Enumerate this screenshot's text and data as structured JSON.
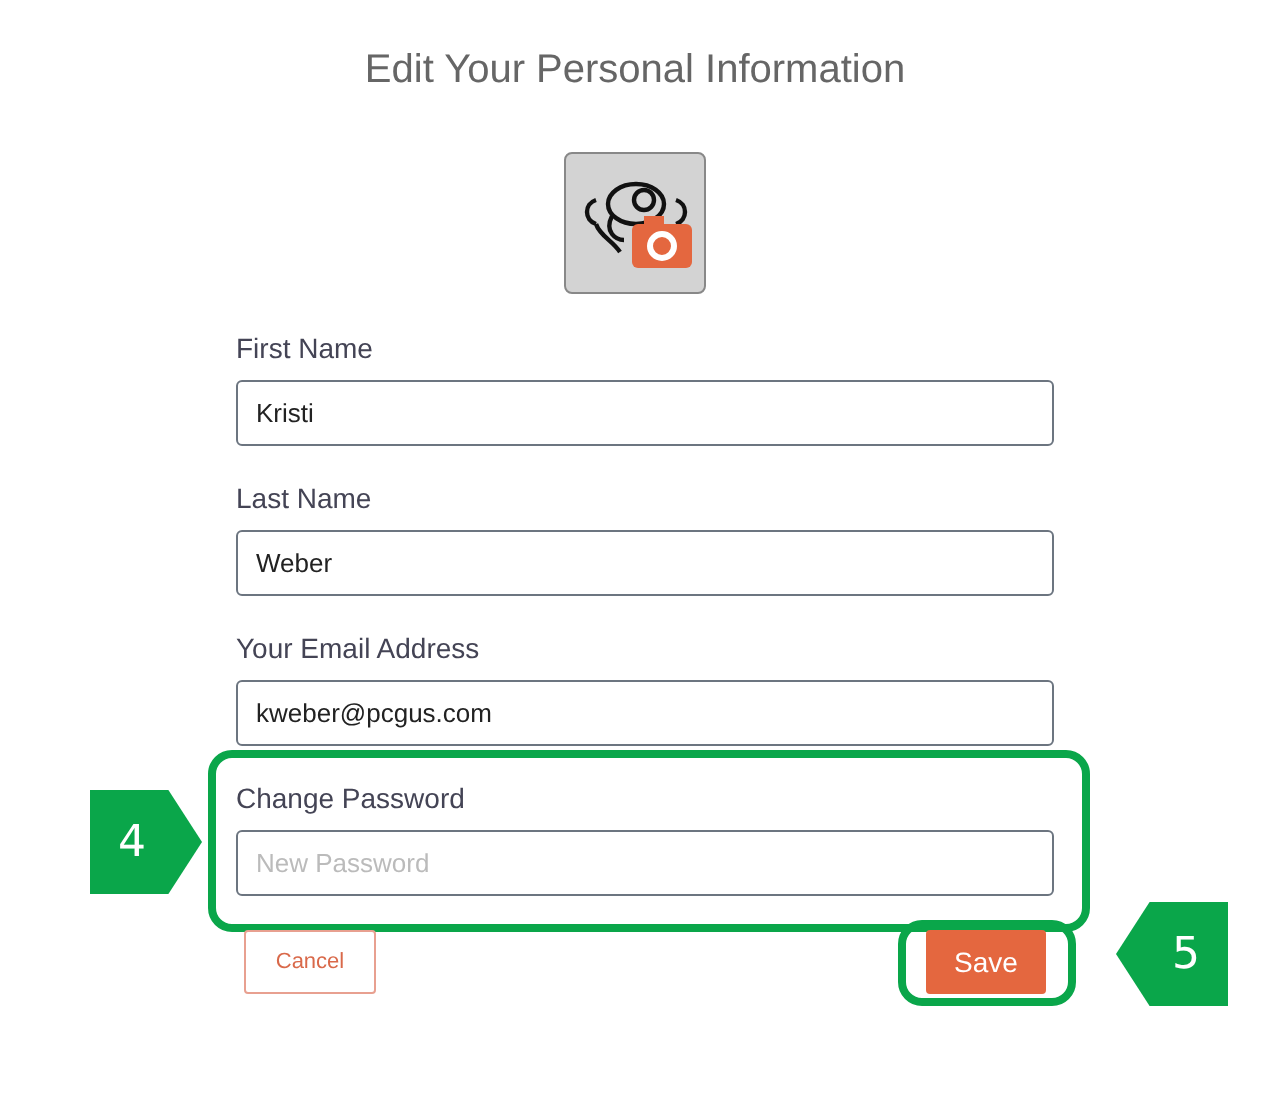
{
  "title": "Edit Your Personal Information",
  "fields": [
    {
      "label": "First Name",
      "value": "Kristi"
    },
    {
      "label": "Last Name",
      "value": "Weber"
    },
    {
      "label": "Your Email Address",
      "value": "kweber@pcgus.com"
    },
    {
      "label": "Change Password",
      "placeholder": "New Password",
      "callout": "4"
    }
  ],
  "buttons": {
    "cancel": "Cancel",
    "save": "Save",
    "save_callout": "5"
  }
}
